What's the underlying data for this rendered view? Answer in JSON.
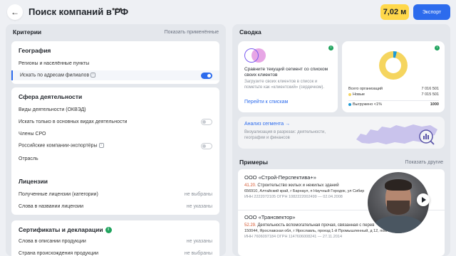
{
  "header": {
    "title": "Поиск компаний в РФ",
    "balance": "7,02 м",
    "export_label": "Экспорт"
  },
  "criteria": {
    "title": "Критерии",
    "show_applied": "Показать применённые",
    "geography": {
      "title": "География",
      "regions": "Регионы и населённые пункты",
      "branch_search": "Искать по адресам филиалов"
    },
    "activity": {
      "title": "Сфера деятельности",
      "okved": "Виды деятельности (ОКВЭД)",
      "main_only": "Искать только в основных видах деятельности",
      "sro": "Члены СРО",
      "exporters": "Российские компании-экспортёры",
      "industry": "Отрасль"
    },
    "licenses": {
      "title": "Лицензии",
      "received": "Полученные лицензии (категории)",
      "received_value": "не выбраны",
      "words": "Слова в названии лицензии",
      "words_value": "не указаны"
    },
    "certificates": {
      "title": "Сертификаты и декларации",
      "product_words": "Слова в описании продукции",
      "product_words_value": "не указаны",
      "origin": "Страна происхождения продукции",
      "origin_value": "не выбраны"
    }
  },
  "summary": {
    "title": "Сводка",
    "compare": {
      "title": "Сравните текущий сегмент со списком своих клиентов",
      "desc": "Загрузите своих клиентов в список и пометьте как «клиентский» (сердечком).",
      "link": "Перейти к спискам"
    },
    "stats": {
      "total_label": "Всего организаций",
      "total_value": "7 016 501",
      "new_label": "Новые",
      "new_value": "7 015 501",
      "exported_label": "Выгружено <1%",
      "exported_value": "1000",
      "exported_share_percent": 1,
      "colors": {
        "new": "#f5d55f",
        "exported": "#1e9bd7"
      }
    },
    "analysis": {
      "link": "Анализ сегмента",
      "arrow": "→",
      "desc": "Визуализация в разрезах: деятельности, географии и финансов"
    }
  },
  "examples": {
    "title": "Примеры",
    "show_others": "Показать другие",
    "items": [
      {
        "name": "ООО «Строй-Перспектива+»",
        "okved_code": "41.20.",
        "okved_text": "Строительство жилых и нежилых зданий",
        "address": "656910, Алтайский край, г Барнаул, п Научный Городок, ул Сибир",
        "ids": "ИНН 2222072105    ОГРН 1082222002499 — 02.04.2008"
      },
      {
        "name": "ООО «Трансвектор»",
        "okved_code": "52.29.",
        "okved_text": "Деятельность вспомогательная прочая, связанная с перев",
        "address": "150044, Ярославская обл, г Ярославль, проезд 1-й Промышленный, д 12, пом 3",
        "ids": "ИНН 7606097184    ОГРН 1147606008241 — 27.11.2014"
      }
    ]
  },
  "icons": {
    "back": "arrow-left-icon",
    "more": "more-horizontal-icon",
    "info": "info-icon",
    "play": "play-icon"
  },
  "colors": {
    "accent": "#2c6bed",
    "balance_bg": "#ffd84a",
    "info_green": "#1fa35d",
    "okved_code": "#d4542c"
  }
}
